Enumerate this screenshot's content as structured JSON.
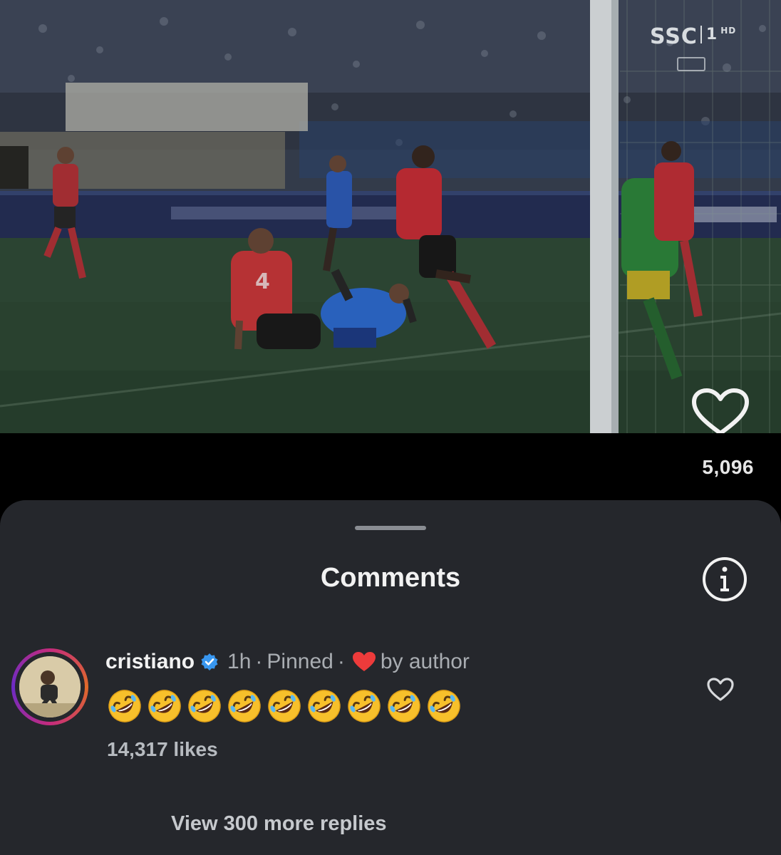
{
  "video": {
    "broadcaster_logo": "SSC",
    "channel_number": "1",
    "channel_sup": "HD",
    "like_count": "5,096"
  },
  "comments_sheet": {
    "title": "Comments"
  },
  "comment": {
    "username": "cristiano",
    "time": "1h",
    "separator": "·",
    "pinned_label": "Pinned",
    "liked_by_author_label": "by author",
    "emoji_text": "🤣🤣🤣🤣🤣🤣🤣🤣🤣",
    "emoji_count": 9,
    "likes": "14,317 likes",
    "view_replies": "View 300 more replies"
  },
  "colors": {
    "sheet_background": "#25272c",
    "verified_blue": "#3897f0",
    "heart_red": "#ed3b3b"
  },
  "icons": [
    "heart-outline-icon",
    "info-icon",
    "verified-badge-icon",
    "red-heart-icon",
    "rolling-laughing-emoji"
  ]
}
